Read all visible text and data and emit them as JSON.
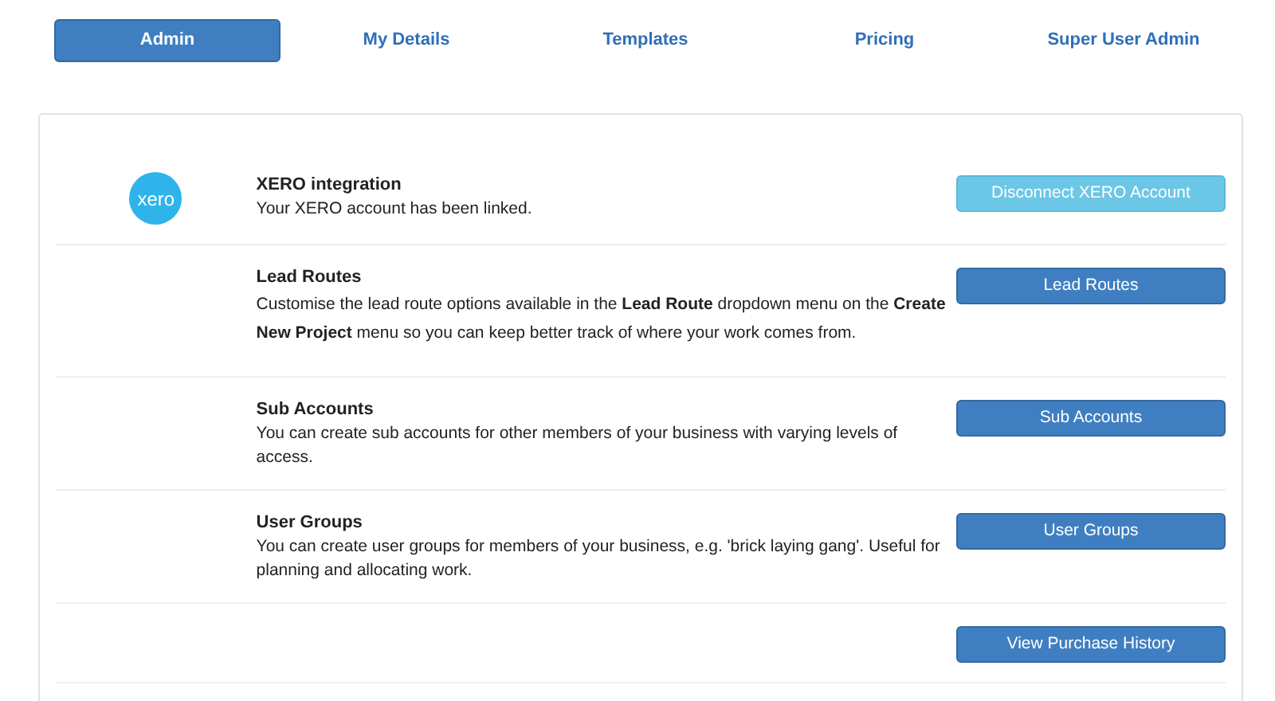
{
  "tabs": [
    {
      "label": "Admin",
      "selected": true
    },
    {
      "label": "My Details",
      "selected": false
    },
    {
      "label": "Templates",
      "selected": false
    },
    {
      "label": "Pricing",
      "selected": false
    },
    {
      "label": "Super User Admin",
      "selected": false
    }
  ],
  "rows": [
    {
      "logo": "xero",
      "title": "XERO integration",
      "description": "Your XERO account has been linked.",
      "button": {
        "label": "Disconnect XERO Account",
        "kind": "info"
      }
    },
    {
      "title": "Lead Routes",
      "description": "Customise the lead route options available in the **Lead Route** dropdown menu on the **Create New Project** menu so you can keep better track of where your work comes from.",
      "button": {
        "label": "Lead Routes",
        "kind": "primary"
      }
    },
    {
      "title": "Sub Accounts",
      "description": "You can create sub accounts for other members of your business with varying levels of access.",
      "button": {
        "label": "Sub Accounts",
        "kind": "primary"
      }
    },
    {
      "title": "User Groups",
      "description": "You can create user groups for members of your business, e.g. 'brick laying gang'. Useful for planning and allocating work.",
      "button": {
        "label": "User Groups",
        "kind": "primary"
      }
    },
    {
      "button": {
        "label": "View Purchase History",
        "kind": "primary"
      }
    }
  ]
}
